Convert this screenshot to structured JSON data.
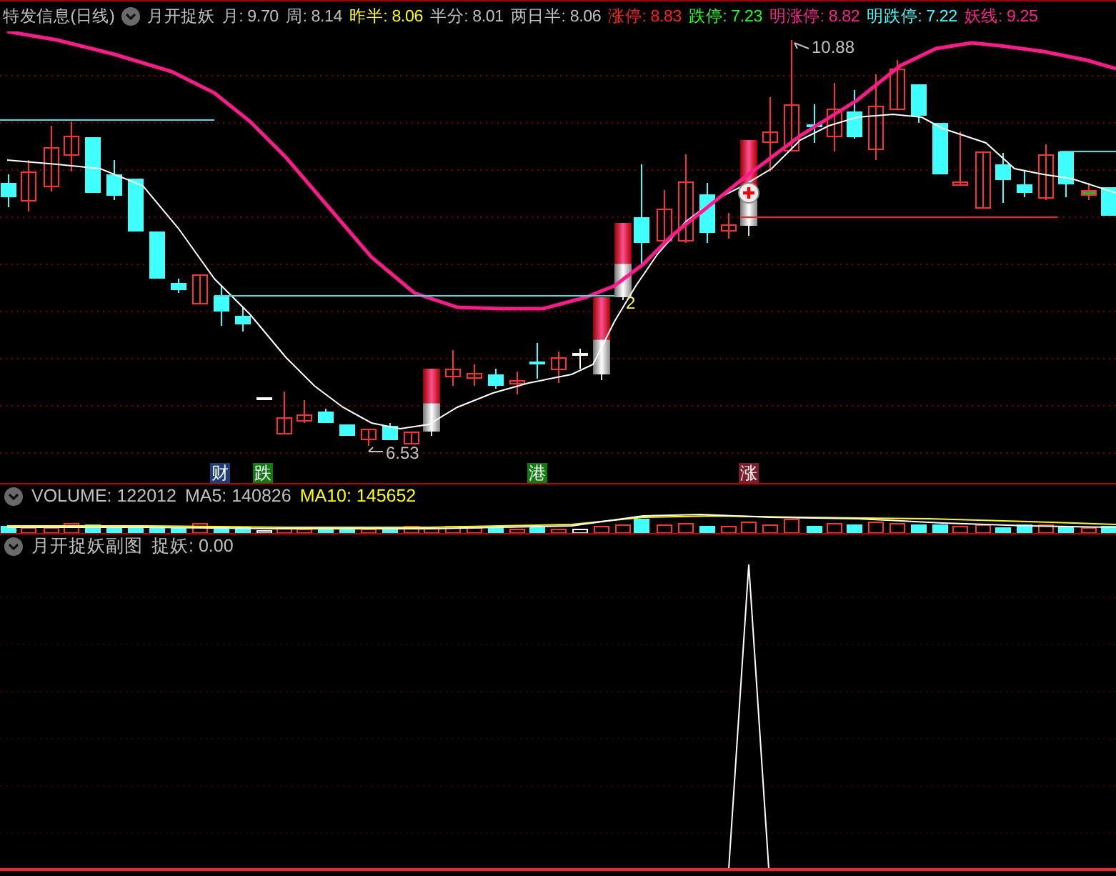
{
  "header": {
    "title": "特发信息(日线)",
    "indicator": "月开捉妖",
    "readings": [
      {
        "text": "月: 9.70",
        "color": "#c0c0c0"
      },
      {
        "text": "周: 8.14",
        "color": "#c0c0c0"
      },
      {
        "text": "昨半: 8.06",
        "color": "#ffff00"
      },
      {
        "text": "半分: 8.01",
        "color": "#c0c0c0"
      },
      {
        "text": "两日半: 8.06",
        "color": "#c0c0c0"
      },
      {
        "text": "涨停: 8.83",
        "color": "#ff2020"
      },
      {
        "text": "跌停: 7.23",
        "color": "#20ff20"
      },
      {
        "text": "明涨停: 8.82",
        "color": "#ff2090"
      },
      {
        "text": "明跌停: 7.22",
        "color": "#40ffff"
      },
      {
        "text": "妖线: 9.25",
        "color": "#ff2090"
      }
    ]
  },
  "main_chart": {
    "high_label": "10.88",
    "low_label": "6.53",
    "signal_label": "2",
    "tags": [
      {
        "text": "财",
        "color": "#1c3f7a"
      },
      {
        "text": "跌",
        "color": "#137a13"
      },
      {
        "text": "港",
        "color": "#137a13"
      },
      {
        "text": "涨",
        "color": "#7a1c2a"
      }
    ]
  },
  "volume_panel": {
    "readings": [
      {
        "text": "VOLUME: 122012",
        "color": "#c0c0c0"
      },
      {
        "text": "MA5: 140826",
        "color": "#c0c0c0"
      },
      {
        "text": "MA10: 145652",
        "color": "#ffff00"
      }
    ]
  },
  "sub_panel": {
    "title": "月开捉妖副图",
    "reading": "捉妖: 0.00"
  }
}
